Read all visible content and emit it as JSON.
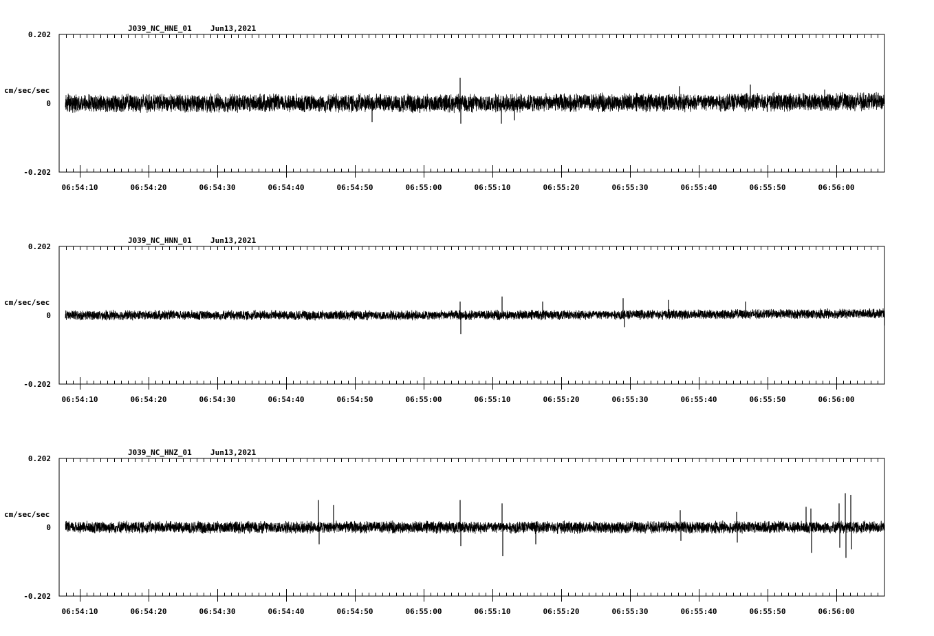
{
  "chart_data": [
    {
      "type": "line",
      "station": "J039_NC_HNE_01",
      "date": "Jun13,2021",
      "ylabel": "cm/sec/sec",
      "ylim": [
        -0.202,
        0.202
      ],
      "ytick_labels": [
        "0.202",
        "0",
        "-0.202"
      ],
      "x_start": "06:54:07",
      "x_end": "06:56:07",
      "xtick_labels": [
        "06:54:10",
        "06:54:20",
        "06:54:30",
        "06:54:40",
        "06:54:50",
        "06:55:00",
        "06:55:10",
        "06:55:20",
        "06:55:30",
        "06:55:40",
        "06:55:50",
        "06:56:00"
      ],
      "noise_amplitude": 0.03,
      "trend": [
        [
          0,
          0.0
        ],
        [
          60,
          0.0
        ],
        [
          120,
          0.005
        ]
      ],
      "spikes": [
        [
          58.3,
          0.075
        ],
        [
          58.4,
          -0.06
        ],
        [
          64.3,
          -0.06
        ],
        [
          66.2,
          -0.05
        ],
        [
          45.5,
          -0.055
        ],
        [
          90.2,
          0.05
        ],
        [
          100.5,
          0.055
        ],
        [
          111.3,
          0.04
        ]
      ]
    },
    {
      "type": "line",
      "station": "J039_NC_HNN_01",
      "date": "Jun13,2021",
      "ylabel": "cm/sec/sec",
      "ylim": [
        -0.202,
        0.202
      ],
      "ytick_labels": [
        "0.202",
        "0",
        "-0.202"
      ],
      "x_start": "06:54:07",
      "x_end": "06:56:07",
      "xtick_labels": [
        "06:54:10",
        "06:54:20",
        "06:54:30",
        "06:54:40",
        "06:54:50",
        "06:55:00",
        "06:55:10",
        "06:55:20",
        "06:55:30",
        "06:55:40",
        "06:55:50",
        "06:56:00"
      ],
      "noise_amplitude": 0.016,
      "trend": [
        [
          0,
          0.0
        ],
        [
          60,
          0.0
        ],
        [
          120,
          0.005
        ]
      ],
      "spikes": [
        [
          58.3,
          0.04
        ],
        [
          58.4,
          -0.055
        ],
        [
          64.4,
          0.055
        ],
        [
          70.3,
          0.04
        ],
        [
          82.0,
          0.05
        ],
        [
          82.2,
          -0.035
        ],
        [
          88.6,
          0.045
        ],
        [
          99.8,
          0.04
        ],
        [
          120,
          -0.03
        ]
      ]
    },
    {
      "type": "line",
      "station": "J039_NC_HNZ_01",
      "date": "Jun13,2021",
      "ylabel": "cm/sec/sec",
      "ylim": [
        -0.202,
        0.202
      ],
      "ytick_labels": [
        "0.202",
        "0",
        "-0.202"
      ],
      "x_start": "06:54:07",
      "x_end": "06:56:07",
      "xtick_labels": [
        "06:54:10",
        "06:54:20",
        "06:54:30",
        "06:54:40",
        "06:54:50",
        "06:55:00",
        "06:55:10",
        "06:55:20",
        "06:55:30",
        "06:55:40",
        "06:55:50",
        "06:56:00"
      ],
      "noise_amplitude": 0.02,
      "trend": [
        [
          0,
          0.0
        ],
        [
          60,
          0.0
        ],
        [
          120,
          0.0
        ]
      ],
      "spikes": [
        [
          37.7,
          0.08
        ],
        [
          37.8,
          -0.05
        ],
        [
          39.9,
          0.065
        ],
        [
          58.3,
          0.08
        ],
        [
          58.4,
          -0.055
        ],
        [
          64.4,
          0.07
        ],
        [
          64.5,
          -0.085
        ],
        [
          69.3,
          -0.05
        ],
        [
          90.3,
          0.05
        ],
        [
          90.4,
          -0.04
        ],
        [
          98.5,
          0.045
        ],
        [
          98.6,
          -0.045
        ],
        [
          108.6,
          0.06
        ],
        [
          109.3,
          0.055
        ],
        [
          109.4,
          -0.075
        ],
        [
          113.4,
          0.07
        ],
        [
          113.5,
          -0.06
        ],
        [
          114.3,
          0.1
        ],
        [
          114.4,
          -0.09
        ],
        [
          115.1,
          0.095
        ],
        [
          115.2,
          -0.065
        ]
      ]
    }
  ]
}
